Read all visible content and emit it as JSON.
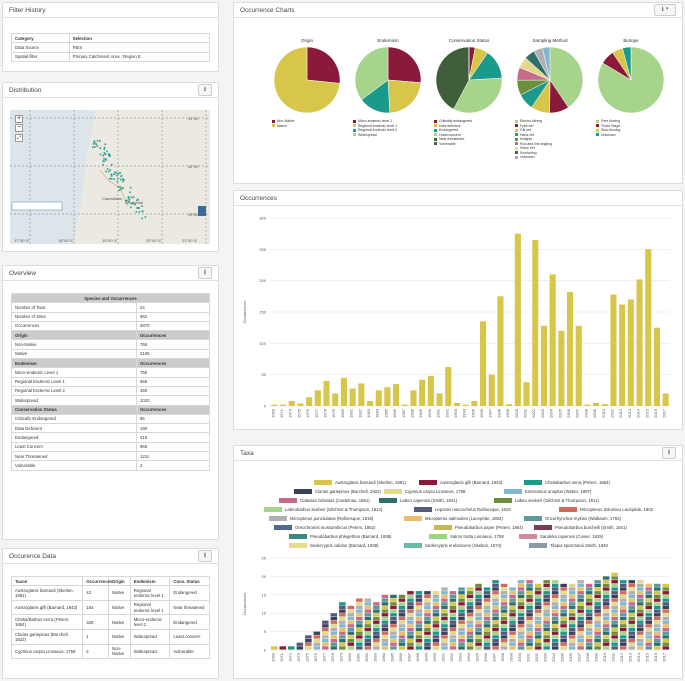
{
  "filter_history": {
    "title": "Filter History",
    "headers": [
      "Category",
      "Selection"
    ],
    "rows": [
      [
        "Data Source",
        "FBIS"
      ],
      [
        "Spatial filter",
        "Primary Catchment Area : Region E"
      ]
    ]
  },
  "distribution": {
    "title": "Distribution",
    "lat_labels": [
      "31°00",
      "32°00",
      "33°00"
    ],
    "lon_labels": [
      "17°00' E",
      "18°00' E",
      "19°00' E",
      "20°00' E",
      "21°00' E"
    ],
    "map_labels": [
      "Clanwilliam",
      "Wuppertal"
    ]
  },
  "overview": {
    "title": "Overview",
    "header": "Species and Occurrences",
    "rows1": [
      [
        "Number of Taxa",
        "24"
      ],
      [
        "Number of Sites",
        "962"
      ],
      [
        "Occurrences",
        "2870"
      ]
    ],
    "origin": {
      "label": "Origin",
      "value_label": "Occurrences",
      "rows": [
        [
          "Non-Native",
          "765"
        ],
        [
          "Native",
          "2105"
        ]
      ]
    },
    "endemism": {
      "label": "Endemism",
      "value_label": "Occurrences",
      "rows": [
        [
          "Micro-endemic Level 1",
          "755"
        ],
        [
          "Regional Endemic Level 1",
          "655"
        ],
        [
          "Regional Endemic Level 2",
          "450"
        ],
        [
          "Widespread",
          "1010"
        ]
      ]
    },
    "conservation": {
      "label": "Conservation Status",
      "value_label": "Occurrences",
      "rows": [
        [
          "Critically Endangered",
          "86"
        ],
        [
          "Data Deficient",
          "190"
        ],
        [
          "Endangered",
          "415"
        ],
        [
          "Least Concern",
          "966"
        ],
        [
          "Near Threatened",
          "1211"
        ],
        [
          "Vulnerable",
          "2"
        ]
      ]
    }
  },
  "occurrence_data": {
    "title": "Occurence Data",
    "headers": [
      "Taxon",
      "Occurrences",
      "Origin",
      "Endemism",
      "Cons. Status"
    ],
    "rows": [
      [
        "Austroglanis barnardi (Skelton, 1981)",
        "42",
        "Native",
        "Regional endemic level 1",
        "Endangered"
      ],
      [
        "Austroglanis gilli (Barnard, 1943)",
        "164",
        "Native",
        "Regional endemic level 1",
        "Near threatened"
      ],
      [
        "Chetia/Barbus serra (Peters, 1864)",
        "326",
        "Native",
        "Micro-endemic level 1",
        "Endangered"
      ],
      [
        "Clarias gariepinus (Burchell, 1822)",
        "1",
        "Native",
        "Widespread",
        "Least concern"
      ],
      [
        "Cyprinus carpio Linnaeus, 1758",
        "2",
        "Non-Native",
        "Widespread",
        "Vulnerable"
      ]
    ]
  },
  "occurrence_charts": {
    "title": "Occurrence Charts",
    "pies": [
      {
        "title": "Origin",
        "slices": [
          {
            "v": 765,
            "c": "#8b1a3a"
          },
          {
            "v": 2105,
            "c": "#d8c64a"
          }
        ],
        "legend": [
          "Non-Native",
          "Native"
        ]
      },
      {
        "title": "Endemism",
        "slices": [
          {
            "v": 755,
            "c": "#8b1a3a"
          },
          {
            "v": 655,
            "c": "#d8c64a"
          },
          {
            "v": 450,
            "c": "#1a9a8a"
          },
          {
            "v": 1010,
            "c": "#a7d48b"
          }
        ],
        "legend": [
          "Micro-endemic level 1",
          "Regional endemic level 1",
          "Regional endemic level 2",
          "Widespread"
        ]
      },
      {
        "title": "Conservation Status",
        "slices": [
          {
            "v": 86,
            "c": "#8b1a3a"
          },
          {
            "v": 190,
            "c": "#d8c64a"
          },
          {
            "v": 415,
            "c": "#1a9a8a"
          },
          {
            "v": 966,
            "c": "#a7d48b"
          },
          {
            "v": 1211,
            "c": "#3f5f3a"
          },
          {
            "v": 2,
            "c": "#555"
          }
        ],
        "legend": [
          "Critically endangered",
          "Data deficient",
          "Endangered",
          "Least concern",
          "Near threatened",
          "Vulnerable"
        ]
      },
      {
        "title": "Sampling Method",
        "slices": [
          {
            "v": 1100,
            "c": "#a7d48b"
          },
          {
            "v": 260,
            "c": "#8b1a3a"
          },
          {
            "v": 250,
            "c": "#d8c64a"
          },
          {
            "v": 220,
            "c": "#1a9a8a"
          },
          {
            "v": 200,
            "c": "#6b8f3a"
          },
          {
            "v": 170,
            "c": "#c86a8a"
          },
          {
            "v": 150,
            "c": "#e4d98a"
          },
          {
            "v": 140,
            "c": "#2f6f6a"
          },
          {
            "v": 120,
            "c": "#b0b0b0"
          },
          {
            "v": 100,
            "c": "#7fb8d0"
          }
        ],
        "legend": [
          "Electro-fishing",
          "Fyke net",
          "Gill net",
          "Hand net",
          "Multiple",
          "Rod and line angling",
          "Seine net",
          "Snorkeling",
          "Unknown"
        ]
      },
      {
        "title": "Biotope",
        "slices": [
          {
            "v": 2400,
            "c": "#a7d48b"
          },
          {
            "v": 200,
            "c": "#8b1a3a"
          },
          {
            "v": 150,
            "c": "#d8c64a"
          },
          {
            "v": 120,
            "c": "#1a9a8a"
          }
        ],
        "legend": [
          "Free flowing",
          "Three Stage",
          "Slow flowing",
          "Unknown"
        ]
      }
    ]
  },
  "occurrences": {
    "title": "Occurrences",
    "chart_data": {
      "type": "bar",
      "xlabel": "",
      "ylabel": "Occurrences",
      "ylim": [
        0,
        300
      ],
      "yticks": [
        0,
        50,
        100,
        150,
        200,
        250,
        300
      ],
      "categories": [
        "1969",
        "1971",
        "1973",
        "1975",
        "1976",
        "1977",
        "1978",
        "1979",
        "1980",
        "1981",
        "1982",
        "1983",
        "1984",
        "1985",
        "1986",
        "1987",
        "1988",
        "1989",
        "1990",
        "1991",
        "1992",
        "1993",
        "1994",
        "1995",
        "1996",
        "1997",
        "1998",
        "1999",
        "2000",
        "2001",
        "2002",
        "2003",
        "2004",
        "2005",
        "2006",
        "2007",
        "2008",
        "2009",
        "2010",
        "2011",
        "2012",
        "2013",
        "2014",
        "2015",
        "2016",
        "2017"
      ],
      "values": [
        2,
        2,
        8,
        4,
        14,
        25,
        40,
        20,
        45,
        28,
        36,
        8,
        25,
        30,
        35,
        2,
        25,
        42,
        48,
        20,
        62,
        5,
        2,
        8,
        135,
        50,
        175,
        3,
        275,
        38,
        265,
        128,
        210,
        120,
        182,
        128,
        2,
        5,
        3,
        178,
        162,
        170,
        202,
        250,
        125,
        20
      ],
      "color": "#d8c64a"
    }
  },
  "taxa": {
    "title": "Taxa",
    "chart_data": {
      "type": "bar",
      "stacked": true,
      "ylabel": "Occurrences",
      "ylim": [
        0,
        25
      ],
      "yticks": [
        0,
        5,
        10,
        15,
        20,
        25
      ],
      "categories": [
        "1969",
        "1971",
        "1972",
        "1973",
        "1975",
        "1976",
        "1977",
        "1978",
        "1979",
        "1980",
        "1981",
        "1982",
        "1983",
        "1984",
        "1985",
        "1986",
        "1987",
        "1988",
        "1989",
        "1990",
        "1991",
        "1992",
        "1993",
        "1994",
        "1995",
        "1996",
        "1997",
        "1998",
        "1999",
        "2000",
        "2001",
        "2002",
        "2003",
        "2004",
        "2005",
        "2006",
        "2007",
        "2008",
        "2009",
        "2010",
        "2011",
        "2012",
        "2013",
        "2014",
        "2015",
        "2016",
        "2017"
      ],
      "totals": [
        1,
        1,
        1,
        2,
        4,
        5,
        8,
        10,
        13,
        12,
        14,
        14,
        13,
        15,
        15,
        15,
        16,
        16,
        16,
        16,
        17,
        16,
        17,
        17,
        18,
        17,
        19,
        18,
        17,
        19,
        19,
        18,
        19,
        19,
        18,
        18,
        19,
        18,
        19,
        20,
        21,
        19,
        19,
        19,
        18,
        18,
        18
      ],
      "colors": [
        "#d8c64a",
        "#8b1a3a",
        "#1a9a8a",
        "#3a3f5a",
        "#e4d98a",
        "#7fb8d0",
        "#c86a8a",
        "#2f6f6a",
        "#6b8f3a",
        "#a7d48b",
        "#555a7a",
        "#d06a5a",
        "#b0b0b0",
        "#e8c06a",
        "#5a9a9a"
      ],
      "series": [
        "Austroglanis barnardi (Skelton, 1981)",
        "Austroglanis gilli (Barnard, 1943)",
        "Chetiabarbus serra (Peters, 1864)",
        "Clarias gariepinus (Burchell, 1822)",
        "Cyprinus carpio Linnaeus, 1758",
        "Enteromius anoplus (Weber, 1897)",
        "Galaxias zebratus (Castelnau, 1861)",
        "Labeo capensis (Smith, 1841)",
        "Labeo seeberi (Gilchrist & Thompson, 1911)",
        "Labeobarbus seeberi (Gilchrist & Thompson, 1913)",
        "Lepomis macrochirus Rafinesque, 1819",
        "Micropterus dolomieu Lacépède, 1802",
        "Micropterus punctulatus (Rafinesque, 1819)",
        "Micropterus salmoides (Lacepède, 1802)",
        "Oncorhynchus mykiss (Walbaum, 1792)",
        "Oreochromis mossambicus (Peters, 1852)",
        "Pseudobarbus asper (Peters, 1864)",
        "Pseudobarbus burchelli (Smith, 1841)",
        "Pseudobarbus phlegethon (Barnard, 1938)",
        "Salmo trutta Linnaeus, 1758",
        "Sandelia capensis (Cuvier, 1829)",
        "Sedercypris calidus (Barnard, 1938)",
        "Sedercypris erubescens (Skelton, 1974)",
        "Tilapia sparrmanii Smith, 1840"
      ],
      "legend_colors": [
        "#d8c64a",
        "#8b1a3a",
        "#1a9a8a",
        "#3a3f5a",
        "#e4d98a",
        "#7fb8d0",
        "#c86a8a",
        "#2f6f6a",
        "#6b8f3a",
        "#a7d48b",
        "#555a7a",
        "#d06a5a",
        "#b0b0b0",
        "#e8c06a",
        "#5a9a9a",
        "#4a6a9a",
        "#c8b84a",
        "#7a3a5a",
        "#3a8a7a",
        "#9ad48b",
        "#d08aa0",
        "#e8dc8a",
        "#6abaa8",
        "#8a9aaa"
      ]
    }
  }
}
